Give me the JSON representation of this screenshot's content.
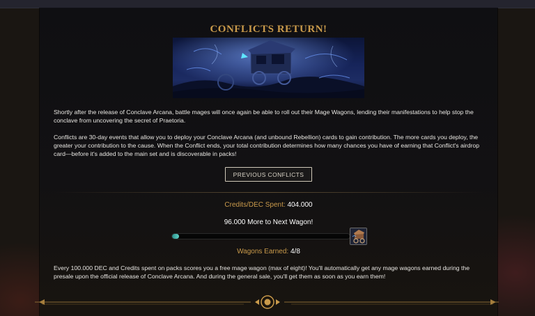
{
  "page": {
    "title": "CONFLICTS RETURN!",
    "intro": "Shortly after the release of Conclave Arcana, battle mages will once again be able to roll out their Mage Wagons, lending their manifestations to help stop the conclave from uncovering the secret of Praetoria.",
    "description": "Conflicts are 30-day events that allow you to deploy your Conclave Arcana (and unbound Rebellion) cards to gain contribution. The more cards you deploy, the greater your contribution to the cause. When the Conflict ends, your total contribution determines how many chances you have of earning that Conflict's airdrop card—before it's added to the main set and is discoverable in packs!",
    "previous_button": "PREVIOUS CONFLICTS",
    "footer_note": "Every 100.000 DEC and Credits spent on packs scores you a free mage wagon (max of eight)! You'll automatically get any mage wagons earned during the presale upon the official release of Conclave Arcana. And during the general sale, you'll get them as soon as you earn them!"
  },
  "stats": {
    "credits_label": "Credits/DEC Spent:",
    "credits_value": "404.000",
    "next_wagon_text": "96.000 More to Next Wagon!",
    "wagons_label": "Wagons Earned:",
    "wagons_value": "4/8",
    "progress_fraction": 0.04
  },
  "icons": {
    "banner": "mage-wagon-artwork",
    "wagon_thumb": "mage-wagon-icon",
    "footer": "ornament-divider"
  },
  "colors": {
    "accent_gold": "#c99a4b",
    "progress_teal": "#5fd2c6",
    "panel_bg": "#0f0f12"
  }
}
